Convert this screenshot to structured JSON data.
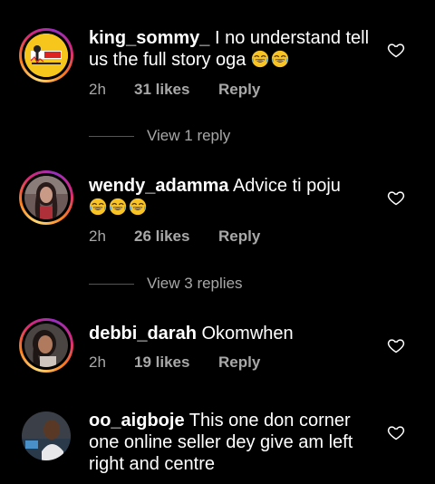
{
  "comments": [
    {
      "username": "king_sommy_",
      "text": "I no understand tell us the full story oga",
      "emoji_count": 2,
      "time": "2h",
      "likes": "31 likes",
      "reply": "Reply",
      "view_replies": "View 1 reply"
    },
    {
      "username": "wendy_adamma",
      "text": "Advice ti poju",
      "emoji_count": 3,
      "time": "2h",
      "likes": "26 likes",
      "reply": "Reply",
      "view_replies": "View 3 replies"
    },
    {
      "username": "debbi_darah",
      "text": "Okomwhen",
      "time": "2h",
      "likes": "19 likes",
      "reply": "Reply"
    },
    {
      "username": "oo_aigboje",
      "text": "This one don corner one online seller dey give am left right and centre"
    }
  ],
  "icons": {
    "like": "heart-outline-icon",
    "emoji": "face-with-tears-of-joy-icon"
  },
  "colors": {
    "background": "#000000",
    "text": "#ffffff",
    "secondary_text": "#a8a8a8",
    "emoji": "#f7c325"
  }
}
